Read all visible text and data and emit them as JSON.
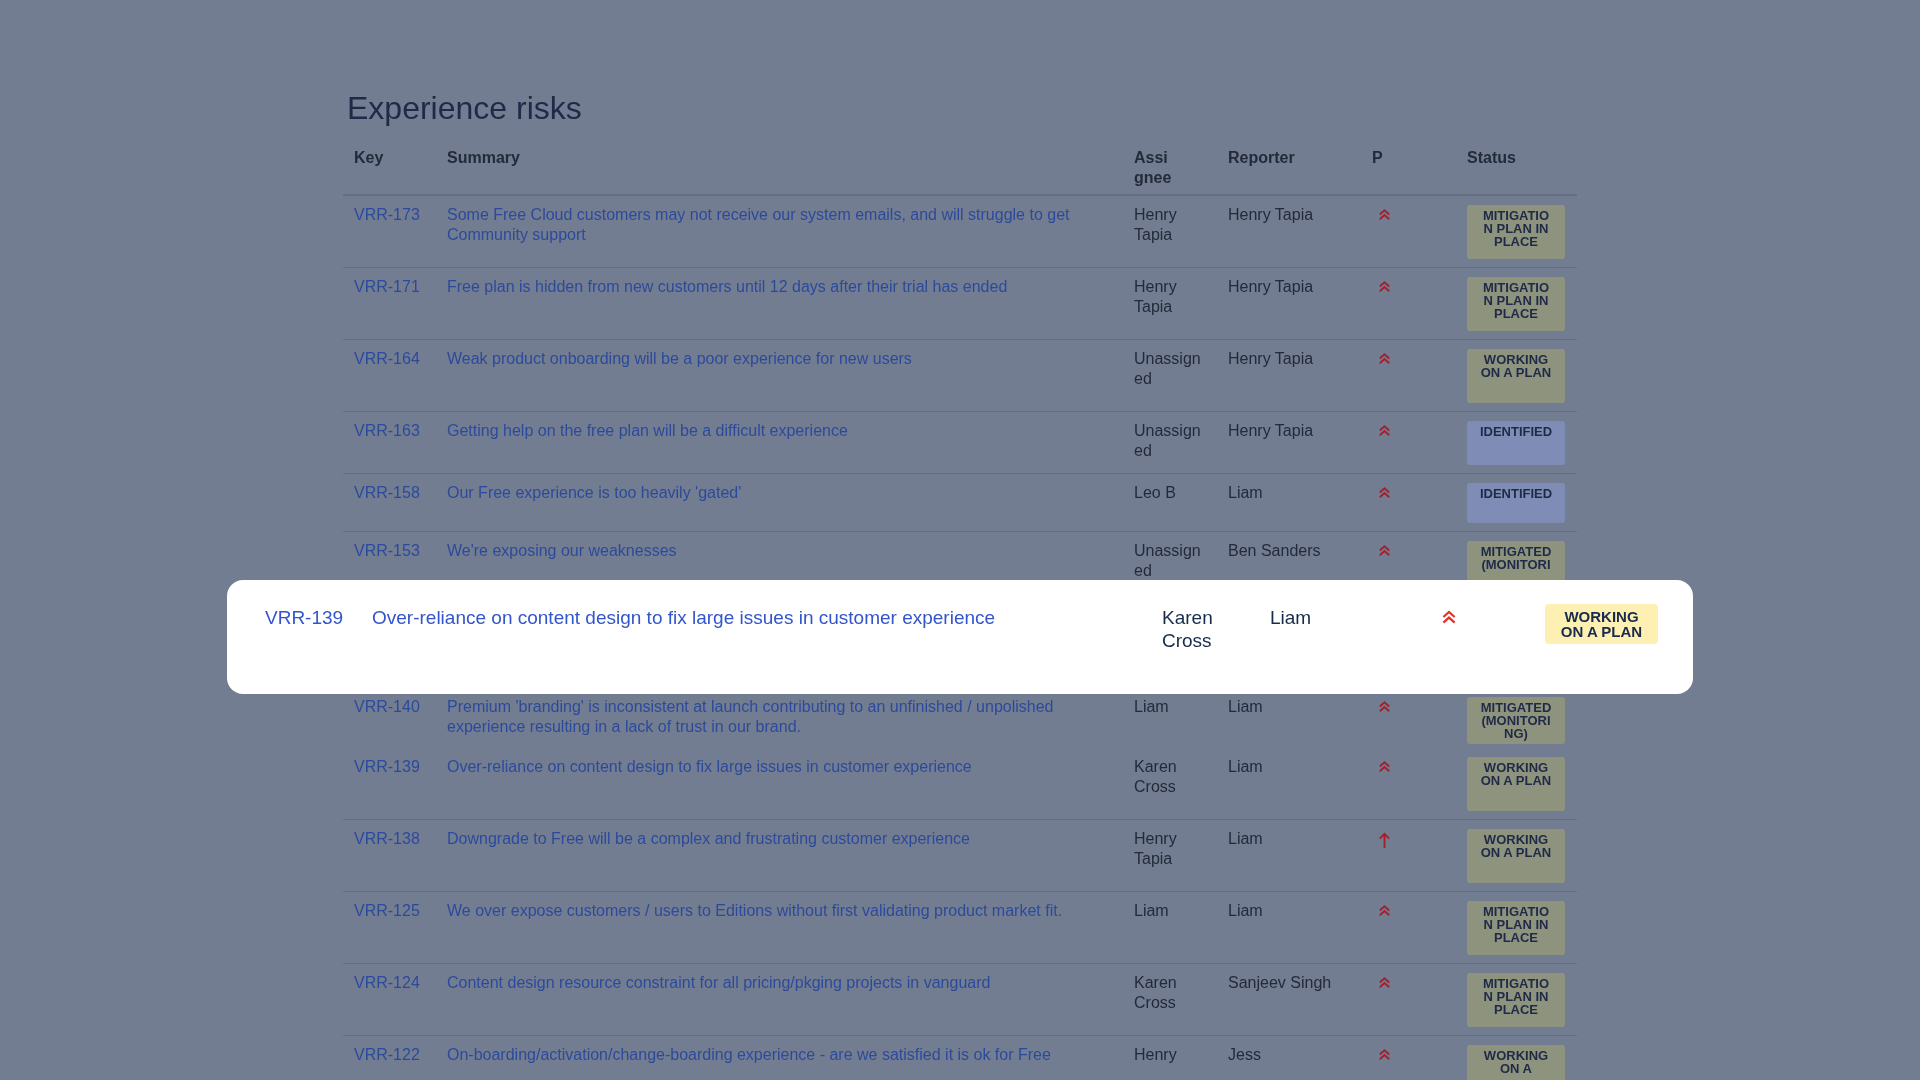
{
  "title": "Experience risks",
  "columns": [
    "Key",
    "Summary",
    "Assi gnee",
    "Reporter",
    "P",
    "Status"
  ],
  "rows_above": [
    {
      "key": "VRR-173",
      "summary": "Some Free Cloud customers may not receive our system emails, and will struggle to get Community support",
      "assignee": "Henry Tapia",
      "reporter": "Henry Tapia",
      "kind": "highest",
      "status": {
        "label": "MITIGATION PLAN IN PLACE",
        "color": "#8e937e"
      }
    },
    {
      "key": "VRR-171",
      "summary": "Free plan is hidden from new customers until 12 days after their trial has ended",
      "assignee": "Henry Tapia",
      "reporter": "Henry Tapia",
      "kind": "highest",
      "status": {
        "label": "MITIGATION PLAN IN PLACE",
        "color": "#8e937e"
      }
    },
    {
      "key": "VRR-164",
      "summary": "Weak product onboarding will be a poor experience for new users",
      "assignee": "Unassigned",
      "reporter": "Henry Tapia",
      "kind": "highest",
      "status": {
        "label": "WORKING ON A PLAN",
        "color": "#8e937e"
      }
    },
    {
      "key": "VRR-163",
      "summary": "Getting help on the free plan will be a difficult experience",
      "assignee": "Unassigned",
      "reporter": "Henry Tapia",
      "kind": "highest",
      "status": {
        "label": "IDENTIFIED",
        "color": "#7f8db6"
      }
    },
    {
      "key": "VRR-158",
      "summary": "Our Free experience is too heavily 'gated'",
      "assignee": "Leo B",
      "reporter": "Liam",
      "kind": "highest",
      "status": {
        "label": "IDENTIFIED",
        "color": "#7f8db6"
      }
    }
  ],
  "row_under_top": {
    "key": "VRR-153",
    "summary": "We're exposing our weaknesses",
    "assignee": "Unassigned",
    "reporter": "Ben Sanders",
    "kind": "highest",
    "status": {
      "label": "MITIGATED (MONITORI",
      "color": "#8e937e"
    }
  },
  "highlighted_row": {
    "key": "VRR-139",
    "summary": "Over-reliance on content design to fix large issues in customer experience",
    "assignee": "Karen Cross",
    "reporter": "Liam",
    "kind": "highest",
    "status": {
      "label": "WORKING ON A PLAN",
      "color": "#fdf0b2"
    }
  },
  "row_under_bottom": {
    "key": "VRR-140",
    "summary": "Premium 'branding' is inconsistent at launch contributing to an unfinished / unpolished experience resulting in a lack of trust in our brand.",
    "assignee": "Liam",
    "reporter": "Liam",
    "kind": "highest",
    "status": {
      "label": "MITIGATED (MONITORING)",
      "color": "#8e937e"
    }
  },
  "rows_below": [
    {
      "key": "VRR-139",
      "summary": "Over-reliance on content design to fix large issues in customer experience",
      "assignee": "Karen Cross",
      "reporter": "Liam",
      "kind": "highest",
      "status": {
        "label": "WORKING ON A PLAN",
        "color": "#8e937e"
      }
    },
    {
      "key": "VRR-138",
      "summary": "Downgrade to Free will be a complex and frustrating customer experience",
      "assignee": "Henry Tapia",
      "reporter": "Liam",
      "kind": "high",
      "status": {
        "label": "WORKING ON A PLAN",
        "color": "#8e937e"
      }
    },
    {
      "key": "VRR-125",
      "summary": "We over expose customers / users to Editions without first validating product market fit.",
      "assignee": "Liam",
      "reporter": "Liam",
      "kind": "highest",
      "status": {
        "label": "MITIGATION PLAN IN PLACE",
        "color": "#8e937e"
      }
    },
    {
      "key": "VRR-124",
      "summary": "Content design resource constraint for all pricing/pkging projects in vanguard",
      "assignee": "Karen Cross",
      "reporter": "Sanjeev Singh",
      "kind": "highest",
      "status": {
        "label": "MITIGATION PLAN IN PLACE",
        "color": "#8e937e"
      }
    },
    {
      "key": "VRR-122",
      "summary": "On-boarding/activation/change-boarding experience - are we satisfied it is ok for Free",
      "assignee": "Henry",
      "reporter": "Jess",
      "kind": "highest",
      "status": {
        "label": "WORKING ON A",
        "color": "#8e937e"
      }
    }
  ]
}
